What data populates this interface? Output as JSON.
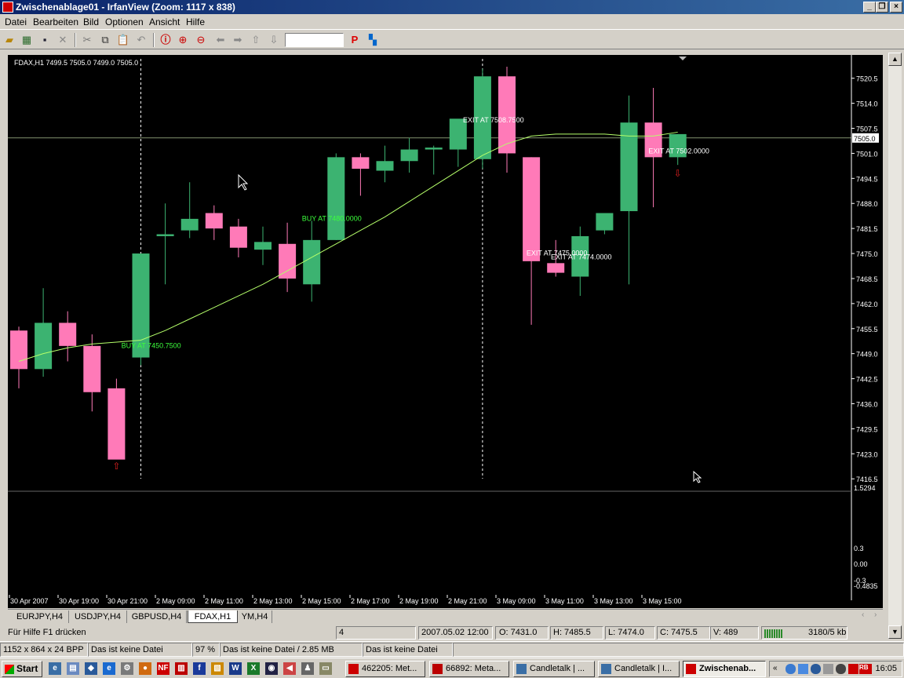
{
  "window": {
    "title": "Zwischenablage01 - IrfanView (Zoom: 1117 x 838)"
  },
  "menu": [
    "Datei",
    "Bearbeiten",
    "Bild",
    "Optionen",
    "Ansicht",
    "Hilfe"
  ],
  "chart_header": "FDAX,H1  7499.5 7505.0 7499.0 7505.0",
  "chart_data": {
    "type": "candlestick",
    "symbol": "FDAX,H1",
    "y_ticks": [
      "7520.5",
      "7514.0",
      "7507.5",
      "7501.0",
      "7494.5",
      "7488.0",
      "7481.5",
      "7475.0",
      "7468.5",
      "7462.0",
      "7455.5",
      "7449.0",
      "7442.5",
      "7436.0",
      "7429.5",
      "7423.0",
      "7416.5"
    ],
    "current_price_label": "7505.0",
    "ylim": [
      7414.5,
      7523.5
    ],
    "candles": [
      {
        "o": 7455,
        "h": 7456,
        "l": 7440,
        "c": 7445
      },
      {
        "o": 7445,
        "h": 7466,
        "l": 7443,
        "c": 7457
      },
      {
        "o": 7457,
        "h": 7460,
        "l": 7447,
        "c": 7451
      },
      {
        "o": 7451,
        "h": 7454,
        "l": 7434,
        "c": 7439
      },
      {
        "o": 7440,
        "h": 7442.5,
        "l": 7422,
        "c": 7421.5
      },
      {
        "o": 7448,
        "h": 7475,
        "l": 7446,
        "c": 7475
      },
      {
        "o": 7479.5,
        "h": 7488,
        "l": 7467,
        "c": 7480
      },
      {
        "o": 7481,
        "h": 7493.5,
        "l": 7479,
        "c": 7484
      },
      {
        "o": 7485.5,
        "h": 7487.5,
        "l": 7478.5,
        "c": 7481.5
      },
      {
        "o": 7482,
        "h": 7484,
        "l": 7474,
        "c": 7476.5
      },
      {
        "o": 7476,
        "h": 7482,
        "l": 7472,
        "c": 7478
      },
      {
        "o": 7477.5,
        "h": 7483,
        "l": 7465,
        "c": 7468.5
      },
      {
        "o": 7467,
        "h": 7483.5,
        "l": 7462.5,
        "c": 7478.5
      },
      {
        "o": 7478.5,
        "h": 7501,
        "l": 7478.5,
        "c": 7500
      },
      {
        "o": 7500,
        "h": 7501,
        "l": 7490,
        "c": 7497
      },
      {
        "o": 7496.5,
        "h": 7503,
        "l": 7493.5,
        "c": 7499
      },
      {
        "o": 7499,
        "h": 7505,
        "l": 7496,
        "c": 7502
      },
      {
        "o": 7502,
        "h": 7503,
        "l": 7495.5,
        "c": 7502.5
      },
      {
        "o": 7502,
        "h": 7509,
        "l": 7497.5,
        "c": 7510
      },
      {
        "o": 7499.5,
        "h": 7523,
        "l": 7497,
        "c": 7521
      },
      {
        "o": 7521,
        "h": 7523.5,
        "l": 7496,
        "c": 7501
      },
      {
        "o": 7500,
        "h": 7500,
        "l": 7456.5,
        "c": 7473
      },
      {
        "o": 7472.5,
        "h": 7478.5,
        "l": 7469,
        "c": 7470
      },
      {
        "o": 7469,
        "h": 7482,
        "l": 7464,
        "c": 7479.5
      },
      {
        "o": 7481,
        "h": 7485,
        "l": 7480,
        "c": 7485.5
      },
      {
        "o": 7486,
        "h": 7516,
        "l": 7467,
        "c": 7509
      },
      {
        "o": 7509,
        "h": 7518,
        "l": 7487,
        "c": 7500
      },
      {
        "o": 7500,
        "h": 7506,
        "l": 7498,
        "c": 7506
      }
    ],
    "ma": [
      7447,
      7449,
      7450.5,
      7451.5,
      7452,
      7452.5,
      7455,
      7458,
      7461,
      7464,
      7467,
      7470.5,
      7474,
      7477.5,
      7481,
      7484.5,
      7488.5,
      7492.5,
      7496.5,
      7500.5,
      7503.5,
      7505.5,
      7506,
      7506,
      7506,
      7505.5,
      7505.5,
      7506.5
    ],
    "x_labels": [
      "30 Apr 2007",
      "30 Apr 19:00",
      "30 Apr 21:00",
      "2 May 09:00",
      "2 May 11:00",
      "2 May 13:00",
      "2 May 15:00",
      "2 May 17:00",
      "2 May 19:00",
      "2 May 21:00",
      "3 May 09:00",
      "3 May 11:00",
      "3 May 13:00",
      "3 May 15:00"
    ],
    "annotations": [
      {
        "text": "BUY AT 7450.7500",
        "color": "green",
        "candle": 4.2,
        "price": 7450.5
      },
      {
        "text": "BUY AT 7480.0000",
        "color": "green",
        "candle": 11.6,
        "price": 7483.5
      },
      {
        "text": "EXIT AT 7508.7500",
        "color": "white",
        "candle": 18.2,
        "price": 7509
      },
      {
        "text": "EXIT AT 7475.0000",
        "color": "white",
        "candle": 20.8,
        "price": 7474.5
      },
      {
        "text": "EXIT AT 7474.0000",
        "color": "white",
        "candle": 21.8,
        "price": 7473.5
      },
      {
        "text": "EXIT AT 7502.0000",
        "color": "white",
        "candle": 25.8,
        "price": 7501
      }
    ],
    "arrows": [
      {
        "type": "up",
        "candle": 4,
        "price": 7419
      },
      {
        "type": "down",
        "candle": 27,
        "price": 7495
      }
    ],
    "sub_indicator_labels": [
      "1.5294",
      "0.3",
      "0.00",
      "-0.3",
      "-0.4835"
    ]
  },
  "tabs": [
    "EURJPY,H4",
    "USDJPY,H4",
    "GBPUSD,H4",
    "FDAX,H1",
    "YM,H4"
  ],
  "mt_status": {
    "help": "Für Hilfe F1 drücken",
    "num": "4",
    "datetime": "2007.05.02 12:00",
    "open": "O: 7431.0",
    "high": "H: 7485.5",
    "low": "L: 7474.0",
    "close": "C: 7475.5",
    "volume": "V: 489",
    "traffic": "3180/5 kb"
  },
  "iv_status": {
    "dims": "1152 x 864 x 24 BPP",
    "file1": "Das ist keine Datei",
    "zoom": "97 %",
    "file2": "Das ist keine Datei / 2.85 MB",
    "file3": "Das ist keine Datei"
  },
  "taskbar": {
    "start": "Start",
    "tasks": [
      "462205: Met...",
      "66892: Meta...",
      "Candletalk | ...",
      "Candletalk | I...",
      "Zwischenab..."
    ],
    "clock": "16:05"
  }
}
